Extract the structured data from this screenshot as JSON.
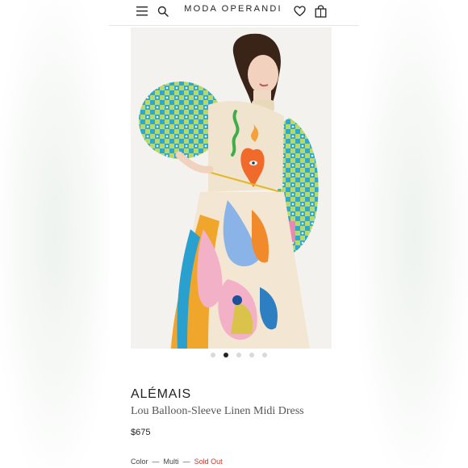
{
  "header": {
    "brand": "MODA OPERANDI",
    "icons": [
      "menu-icon",
      "search-icon",
      "heart-icon",
      "shopping-bag-icon"
    ]
  },
  "gallery": {
    "image_count": 5,
    "active_index": 1
  },
  "product": {
    "designer": "ALÉMAIS",
    "name": "Lou Balloon-Sleeve Linen Midi Dress",
    "price": "$675",
    "color_label": "Color",
    "separator": "—",
    "color_value": "Multi",
    "status": "Sold Out"
  },
  "colors": {
    "accent_sold_out": "#c0392b",
    "text": "#222222"
  }
}
